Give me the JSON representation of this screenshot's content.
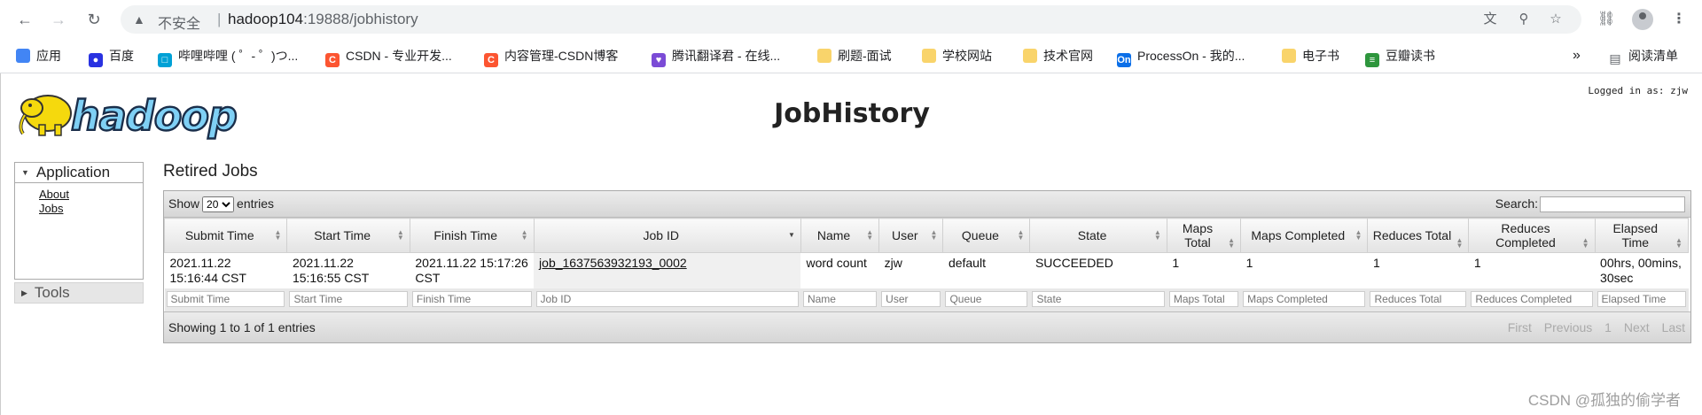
{
  "browser": {
    "insecure_label": "不安全",
    "url_host": "hadoop104",
    "url_rest": ":19888/jobhistory",
    "bookmarks": [
      {
        "label": "应用",
        "color": "#4285f4"
      },
      {
        "label": "百度",
        "color": "#2932e1"
      },
      {
        "label": "哔哩哔哩 ( ゜- ゜)つ...",
        "color": "#00a1d6"
      },
      {
        "label": "CSDN - 专业开发...",
        "color": "#fc5531"
      },
      {
        "label": "内容管理-CSDN博客",
        "color": "#fc5531"
      },
      {
        "label": "腾讯翻译君 - 在线...",
        "color": "#7b4bd6"
      },
      {
        "label": "刷题-面试",
        "color": "#f9d46b"
      },
      {
        "label": "学校网站",
        "color": "#f9d46b"
      },
      {
        "label": "技术官网",
        "color": "#f9d46b"
      },
      {
        "label": "ProcessOn - 我的...",
        "color": "#0b6fe8"
      },
      {
        "label": "电子书",
        "color": "#f9d46b"
      },
      {
        "label": "豆瓣读书",
        "color": "#2e963d"
      }
    ],
    "more": "»",
    "reading_list": "阅读清单"
  },
  "page": {
    "title": "JobHistory",
    "logged_in": "Logged in as: zjw",
    "logo_text": "hadoop"
  },
  "nav": {
    "application": "Application",
    "links": [
      "About",
      "Jobs"
    ],
    "tools": "Tools"
  },
  "jobs": {
    "section_title": "Retired Jobs",
    "show_label": "Show",
    "entries_label": "entries",
    "page_size": "20",
    "search_label": "Search:",
    "columns": [
      "Submit Time",
      "Start Time",
      "Finish Time",
      "Job ID",
      "Name",
      "User",
      "Queue",
      "State",
      "Maps Total",
      "Maps Completed",
      "Reduces Total",
      "Reduces Completed",
      "Elapsed Time"
    ],
    "rows": [
      {
        "submit_time": "2021.11.22 15:16:44 CST",
        "start_time": "2021.11.22 15:16:55 CST",
        "finish_time": "2021.11.22 15:17:26 CST",
        "job_id": "job_1637563932193_0002",
        "name": "word count",
        "user": "zjw",
        "queue": "default",
        "state": "SUCCEEDED",
        "maps_total": "1",
        "maps_completed": "1",
        "reduces_total": "1",
        "reduces_completed": "1",
        "elapsed": "00hrs, 00mins, 30sec"
      }
    ],
    "info": "Showing 1 to 1 of 1 entries",
    "pager": {
      "first": "First",
      "previous": "Previous",
      "page": "1",
      "next": "Next",
      "last": "Last"
    }
  },
  "watermark": "CSDN @孤独的偷学者"
}
